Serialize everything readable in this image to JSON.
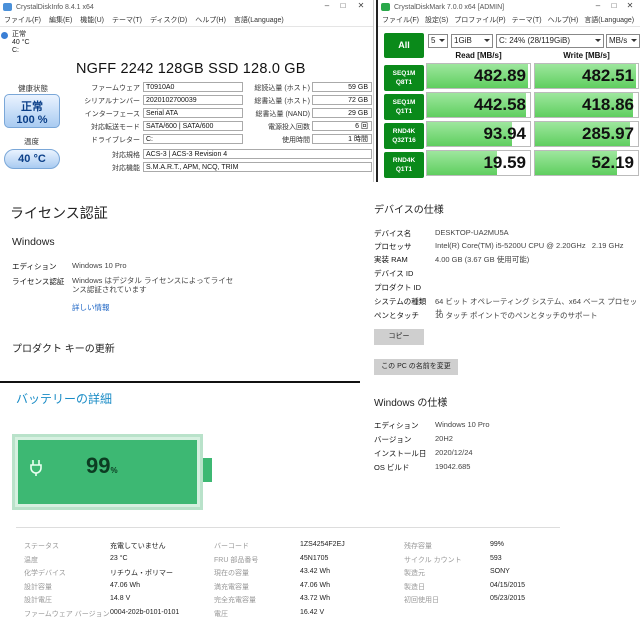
{
  "cdi": {
    "window_title": "CrystalDiskInfo 8.4.1 x64",
    "menu": [
      "ファイル(F)",
      "編集(E)",
      "機能(U)",
      "テーマ(T)",
      "ディスク(D)",
      "ヘルプ(H)",
      "言語(Language)"
    ],
    "drive_tab": {
      "status": "正常",
      "temp": "40 °C",
      "letter": "C:"
    },
    "model": "NGFF 2242 128GB SSD 128.0 GB",
    "health_label": "健康状態",
    "health_status": "正常",
    "health_pct": "100 %",
    "temp_label": "温度",
    "temp_value": "40 °C",
    "left_rows": [
      {
        "label": "ファームウェア",
        "value": "T0910A0"
      },
      {
        "label": "シリアルナンバー",
        "value": "2020102700039"
      },
      {
        "label": "インターフェース",
        "value": "Serial ATA"
      },
      {
        "label": "対応転送モード",
        "value": "SATA/600 | SATA/600"
      },
      {
        "label": "ドライブレター",
        "value": "C:"
      }
    ],
    "right_rows": [
      {
        "label": "総読込量 (ホスト)",
        "value": "59 GB"
      },
      {
        "label": "総書込量 (ホスト)",
        "value": "72 GB"
      },
      {
        "label": "総書込量 (NAND)",
        "value": "29 GB"
      },
      {
        "label": "電源投入回数",
        "value": "6 回"
      },
      {
        "label": "使用時間",
        "value": "1 時間"
      }
    ],
    "std_label": "対応規格",
    "std_value": "ACS-3 | ACS-3 Revision 4",
    "feat_label": "対応機能",
    "feat_value": "S.M.A.R.T., APM, NCQ, TRIM"
  },
  "cdm": {
    "window_title": "CrystalDiskMark 7.0.0 x64 [ADMIN]",
    "menu": [
      "ファイル(F)",
      "設定(S)",
      "プロファイル(P)",
      "テーマ(T)",
      "ヘルプ(H)",
      "言語(Language)"
    ],
    "all_label": "All",
    "count": "5",
    "size": "1GiB",
    "drive": "C: 24% (28/119GiB)",
    "unit": "MB/s",
    "read_header": "Read [MB/s]",
    "write_header": "Write [MB/s]",
    "tests": [
      {
        "l1": "SEQ1M",
        "l2": "Q8T1",
        "read": "482.89",
        "write": "482.51"
      },
      {
        "l1": "SEQ1M",
        "l2": "Q1T1",
        "read": "442.58",
        "write": "418.86"
      },
      {
        "l1": "RND4K",
        "l2": "Q32T16",
        "read": "93.94",
        "write": "285.97"
      },
      {
        "l1": "RND4K",
        "l2": "Q1T1",
        "read": "19.59",
        "write": "52.19"
      }
    ],
    "accent": "#0a8a1a"
  },
  "license": {
    "title": "ライセンス認証",
    "windows_h": "Windows",
    "edition_label": "エディション",
    "edition_value": "Windows 10 Pro",
    "lic_label": "ライセンス認証",
    "lic_value": "Windows はデジタル ライセンスによってライセンス認証されています",
    "details_link": "詳しい情報",
    "product_key_h": "プロダクト キーの更新"
  },
  "device": {
    "title": "デバイスの仕様",
    "rows": [
      {
        "k": "デバイス名",
        "v": "DESKTOP-UA2MU5A"
      },
      {
        "k": "プロセッサ",
        "v": "Intel(R) Core(TM) i5-5200U CPU @ 2.20GHz   2.19 GHz"
      },
      {
        "k": "実装 RAM",
        "v": "4.00 GB (3.67 GB 使用可能)"
      },
      {
        "k": "デバイス ID",
        "v": ""
      },
      {
        "k": "プロダクト ID",
        "v": ""
      },
      {
        "k": "システムの種類",
        "v": "64 ビット オペレーティング システム、x64 ベース プロセッサ"
      },
      {
        "k": "ペンとタッチ",
        "v": "10 タッチ ポイントでのペンとタッチのサポート"
      }
    ],
    "copy_btn": "コピー",
    "rename_btn": "この PC の名前を変更"
  },
  "winspec": {
    "title": "Windows の仕様",
    "rows": [
      {
        "k": "エディション",
        "v": "Windows 10 Pro"
      },
      {
        "k": "バージョン",
        "v": "20H2"
      },
      {
        "k": "インストール日",
        "v": "2020/12/24"
      },
      {
        "k": "OS ビルド",
        "v": "19042.685"
      }
    ]
  },
  "battery": {
    "title": "バッテリーの詳細",
    "percent": "99",
    "percent_unit": "%",
    "level": 0.99,
    "col1": [
      {
        "k": "ステータス",
        "v": "充電していません"
      },
      {
        "k": "温度",
        "v": "23 °C"
      },
      {
        "k": "化学デバイス",
        "v": "リチウム・ポリマー"
      },
      {
        "k": "設計容量",
        "v": "47.06 Wh"
      },
      {
        "k": "設計電圧",
        "v": "14.8 V"
      },
      {
        "k": "ファームウェア バージョン",
        "v": "0004-202b-0101-0101"
      }
    ],
    "col2": [
      {
        "k": "バーコード",
        "v": "1ZS4254F2EJ"
      },
      {
        "k": "FRU 部品番号",
        "v": "45N1705"
      },
      {
        "k": "現在の容量",
        "v": "43.42 Wh"
      },
      {
        "k": "満充電容量",
        "v": "47.06 Wh"
      },
      {
        "k": "完全充電容量",
        "v": "43.72 Wh"
      },
      {
        "k": "電圧",
        "v": "16.42 V"
      }
    ],
    "col3": [
      {
        "k": "残存容量",
        "v": "99%"
      },
      {
        "k": "サイクル カウント",
        "v": "593"
      },
      {
        "k": "製造元",
        "v": "SONY"
      },
      {
        "k": "製造日",
        "v": "04/15/2015"
      },
      {
        "k": "初回使用日",
        "v": "05/23/2015"
      }
    ],
    "accent": "#3db873"
  }
}
